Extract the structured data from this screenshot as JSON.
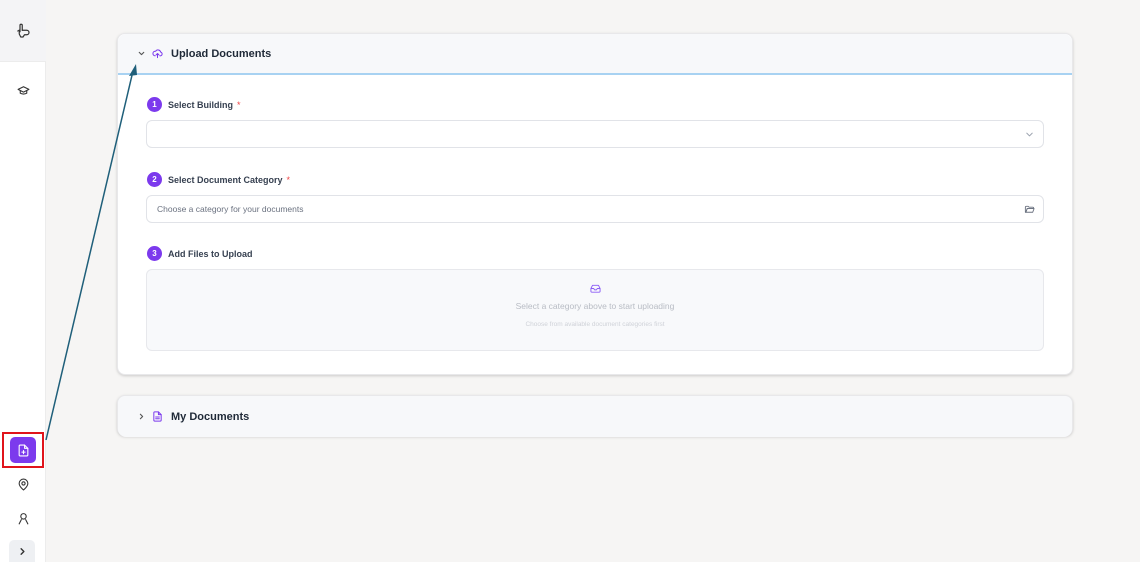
{
  "sidebar": {
    "logo_icon": "pointing-hand-logo-icon",
    "items": [
      {
        "icon": "graduation-cap-icon"
      },
      {
        "icon": "file-upload-icon",
        "active": true
      },
      {
        "icon": "map-pin-icon"
      },
      {
        "icon": "user-icon"
      },
      {
        "icon": "chevron-right-icon"
      }
    ]
  },
  "upload_section": {
    "title": "Upload Documents",
    "expanded": true,
    "steps": [
      {
        "number": "1",
        "label": "Select Building",
        "required": "*"
      },
      {
        "number": "2",
        "label": "Select Document Category",
        "required": "*"
      },
      {
        "number": "3",
        "label": "Add Files to Upload"
      }
    ],
    "building_select": {
      "value": ""
    },
    "category_select": {
      "placeholder": "Choose a category for your documents"
    },
    "dropzone": {
      "title": "Select a category above to start uploading",
      "subtitle": "Choose from available document categories first"
    }
  },
  "documents_section": {
    "title": "My Documents",
    "expanded": false
  },
  "colors": {
    "accent": "#7c3aed",
    "highlight_box": "#e0141b",
    "annotation_arrow": "#1f5f7a",
    "header_divider": "#a8d2f2"
  }
}
